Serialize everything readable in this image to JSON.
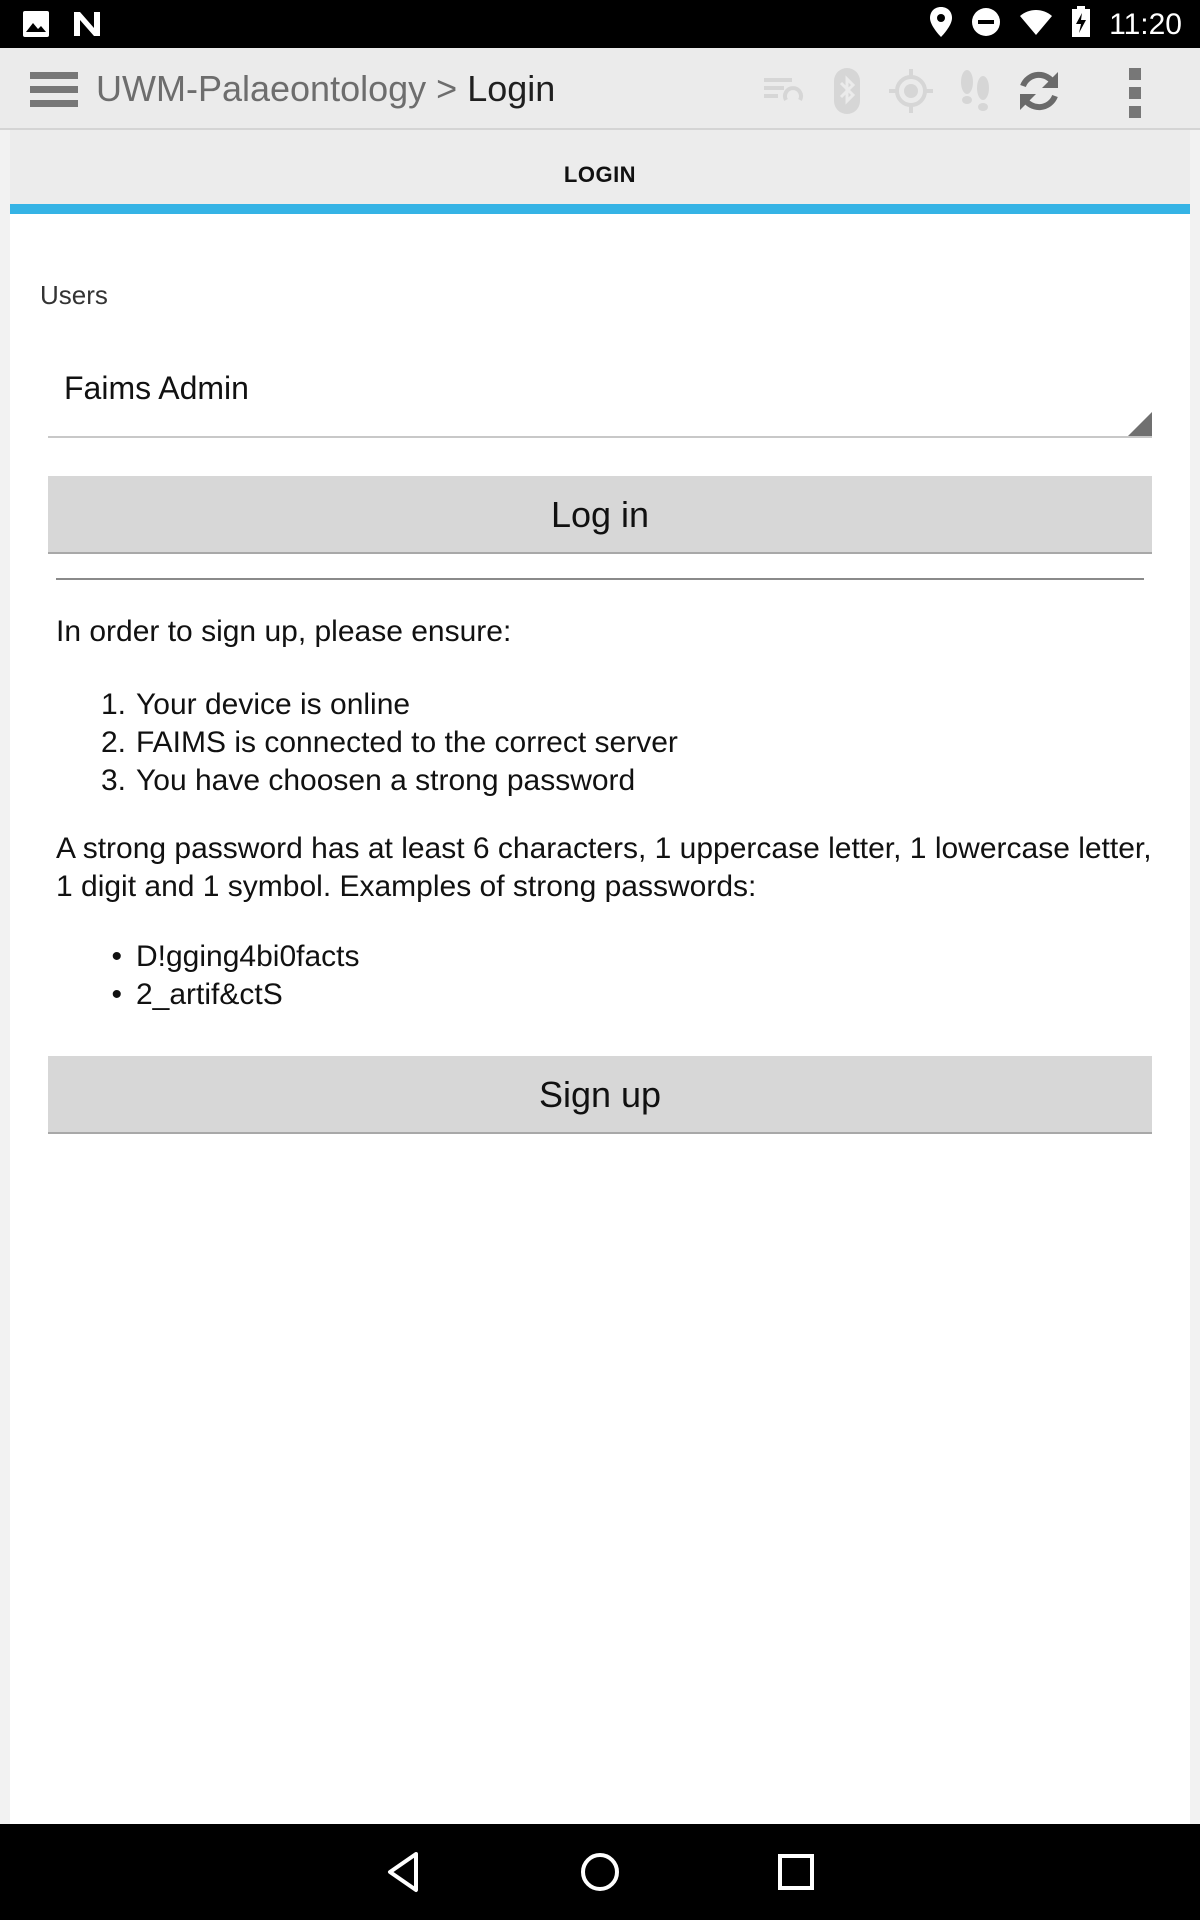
{
  "status_bar": {
    "time": "11:20",
    "icons": [
      "image-icon",
      "n-notification-icon",
      "location-icon",
      "do-not-disturb-icon",
      "wifi-icon",
      "battery-charging-icon"
    ]
  },
  "action_bar": {
    "project": "UWM-Palaeontology",
    "separator": ">",
    "page": "Login",
    "icons": [
      "menu-icon",
      "sync-list-icon",
      "bluetooth-icon",
      "gps-icon",
      "tracking-icon",
      "refresh-icon",
      "overflow-menu-icon"
    ]
  },
  "tabs": [
    {
      "label": "LOGIN"
    }
  ],
  "colors": {
    "accent": "#35b3e5",
    "action_bar_bg": "#ebebeb",
    "button_bg": "#d7d7d7"
  },
  "form": {
    "users_label": "Users",
    "selected_user": "Faims Admin",
    "login_label": "Log in",
    "signup_intro": "In order to sign up, please ensure:",
    "requirements": [
      {
        "num": "1.",
        "text": "Your device is online"
      },
      {
        "num": "2.",
        "text": "FAIMS is connected to the correct server"
      },
      {
        "num": "3.",
        "text": "You have choosen a strong password"
      }
    ],
    "password_note": "A strong password has at least 6 characters, 1 uppercase letter, 1 lowercase letter, 1 digit and 1 symbol. Examples of strong passwords:",
    "examples": [
      "D!gging4bi0facts",
      "2_artif&ctS"
    ],
    "signup_label": "Sign up"
  },
  "nav_bar": {
    "icons": [
      "back-icon",
      "home-icon",
      "recents-icon"
    ]
  }
}
